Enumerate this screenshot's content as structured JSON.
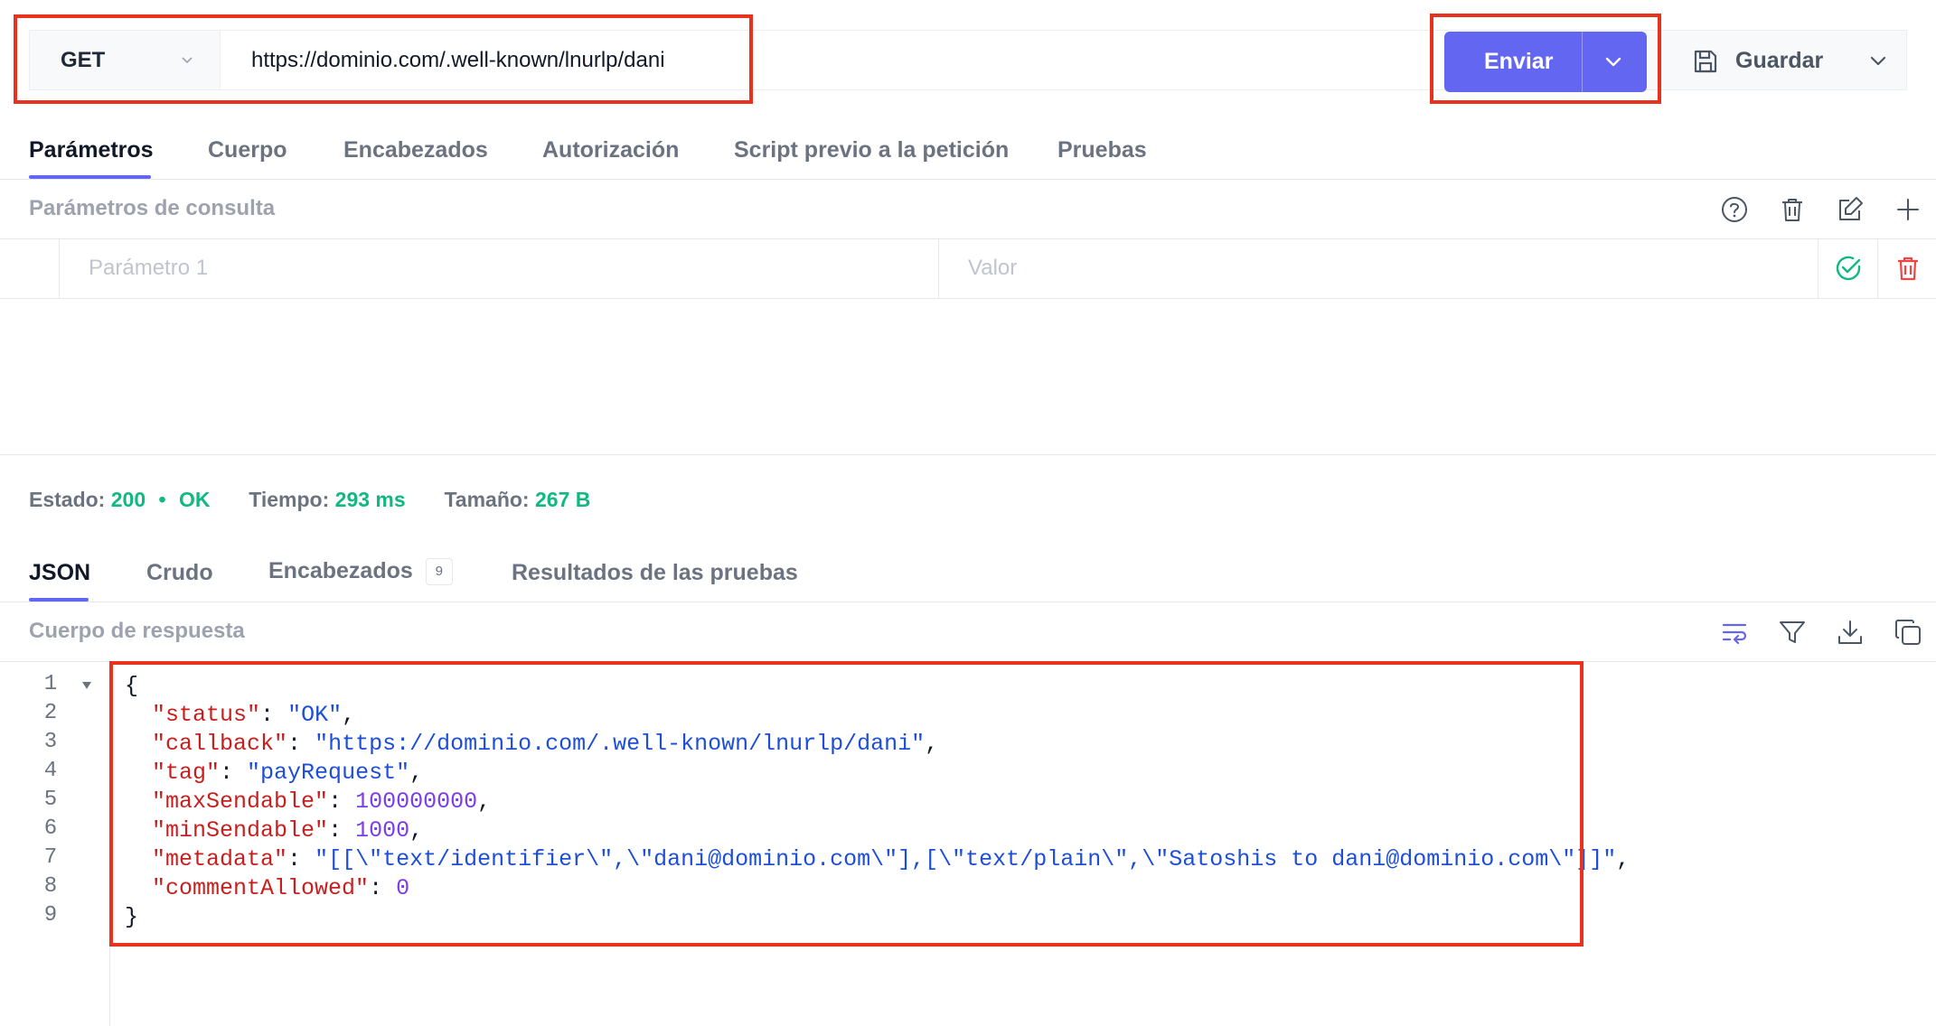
{
  "request": {
    "method": "GET",
    "url": "https://dominio.com/.well-known/lnurlp/dani",
    "send_label": "Enviar",
    "save_label": "Guardar"
  },
  "request_tabs": [
    {
      "label": "Parámetros",
      "active": true
    },
    {
      "label": "Cuerpo",
      "active": false
    },
    {
      "label": "Encabezados",
      "active": false
    },
    {
      "label": "Autorización",
      "active": false
    },
    {
      "label": "Script previo a la petición",
      "active": false
    },
    {
      "label": "Pruebas",
      "active": false
    }
  ],
  "query_params": {
    "title": "Parámetros de consulta",
    "key_placeholder": "Parámetro 1",
    "value_placeholder": "Valor",
    "tools": [
      "help-icon",
      "trash-icon",
      "edit-icon",
      "plus-icon"
    ]
  },
  "status": {
    "status_label": "Estado:",
    "status_code": "200",
    "status_sep": "•",
    "status_text": "OK",
    "time_label": "Tiempo:",
    "time_value": "293 ms",
    "size_label": "Tamaño:",
    "size_value": "267 B"
  },
  "response_tabs": [
    {
      "label": "JSON",
      "active": true
    },
    {
      "label": "Crudo",
      "active": false
    },
    {
      "label": "Encabezados",
      "active": false,
      "badge": "9"
    },
    {
      "label": "Resultados de las pruebas",
      "active": false
    }
  ],
  "response": {
    "title": "Cuerpo de respuesta",
    "tools": [
      "wrap-icon",
      "filter-icon",
      "download-icon",
      "copy-icon"
    ],
    "line_numbers": [
      "1",
      "2",
      "3",
      "4",
      "5",
      "6",
      "7",
      "8",
      "9"
    ],
    "lines": [
      {
        "open": "{"
      },
      {
        "key": "\"status\"",
        "sep": ": ",
        "str": "\"OK\"",
        "end": ","
      },
      {
        "key": "\"callback\"",
        "sep": ": ",
        "str": "\"https://dominio.com/.well-known/lnurlp/dani\"",
        "end": ","
      },
      {
        "key": "\"tag\"",
        "sep": ": ",
        "str": "\"payRequest\"",
        "end": ","
      },
      {
        "key": "\"maxSendable\"",
        "sep": ": ",
        "num": "100000000",
        "end": ","
      },
      {
        "key": "\"minSendable\"",
        "sep": ": ",
        "num": "1000",
        "end": ","
      },
      {
        "key": "\"metadata\"",
        "sep": ": ",
        "str": "\"[[\\\"text/identifier\\\",\\\"dani@dominio.com\\\"],[\\\"text/plain\\\",\\\"Satoshis to dani@dominio.com\\\"]]\"",
        "end": ","
      },
      {
        "key": "\"commentAllowed\"",
        "sep": ": ",
        "num": "0",
        "end": ""
      },
      {
        "open": "}"
      }
    ]
  },
  "colors": {
    "accent": "#6366f1",
    "success": "#10b981",
    "danger": "#ef4444",
    "highlight": "#e8321e"
  }
}
